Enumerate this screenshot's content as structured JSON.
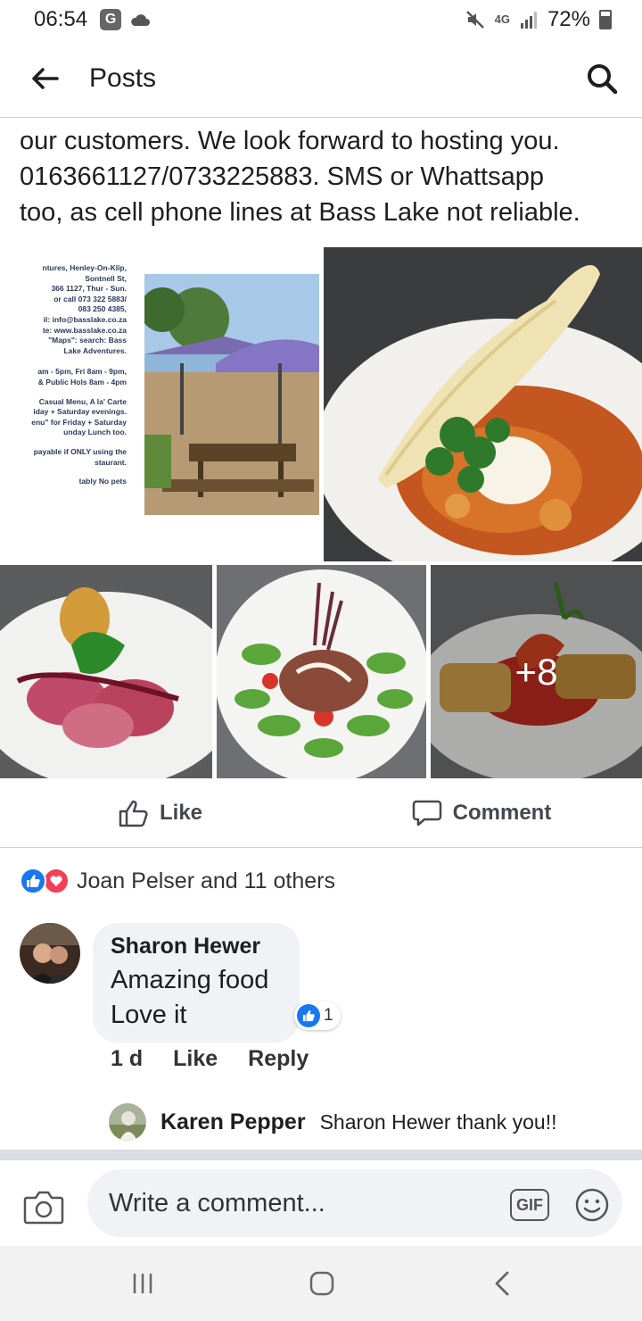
{
  "status_bar": {
    "time": "06:54",
    "g_badge": "G",
    "network": "4G",
    "battery": "72%"
  },
  "header": {
    "title": "Posts"
  },
  "post": {
    "text_lines": [
      "our customers. We look forward to hosting you.",
      "0163661127/0733225883. SMS or Whattsapp",
      "too, as cell phone lines at Bass Lake not reliable."
    ],
    "flyer_text": [
      "ntures, Henley-On-Klip,",
      "Sontnell St,",
      "366 1127, Thur - Sun.",
      "or call 073 322 5883/",
      "083 250 4385,",
      "il: info@basslake.co.za",
      "te: www.basslake.co.za",
      "\"Maps\": search: Bass",
      "Lake Adventures.",
      "am - 5pm, Fri 8am - 9pm,",
      "& Public Hols 8am - 4pm",
      "Casual Menu, A la' Carte",
      "iday + Saturday evenings.",
      "enu\" for Friday + Saturday",
      "unday Lunch too.",
      "payable if ONLY using the",
      "staurant.",
      "tably No pets"
    ],
    "more_photos": "+8"
  },
  "actions": {
    "like": "Like",
    "comment": "Comment"
  },
  "reactions": {
    "summary": "Joan Pelser and 11 others"
  },
  "comment": {
    "author": "Sharon Hewer",
    "text_line1": "Amazing food",
    "text_line2": "Love it",
    "reaction_count": "1",
    "time": "1 d",
    "like": "Like",
    "reply": "Reply"
  },
  "reply": {
    "author": "Karen Pepper",
    "text": "Sharon Hewer thank you!!"
  },
  "composer": {
    "placeholder": "Write a comment...",
    "gif_label": "GIF"
  },
  "colors": {
    "like_blue": "#1877f2",
    "love_red": "#f33e58",
    "bubble_gray": "#f0f2f5"
  }
}
